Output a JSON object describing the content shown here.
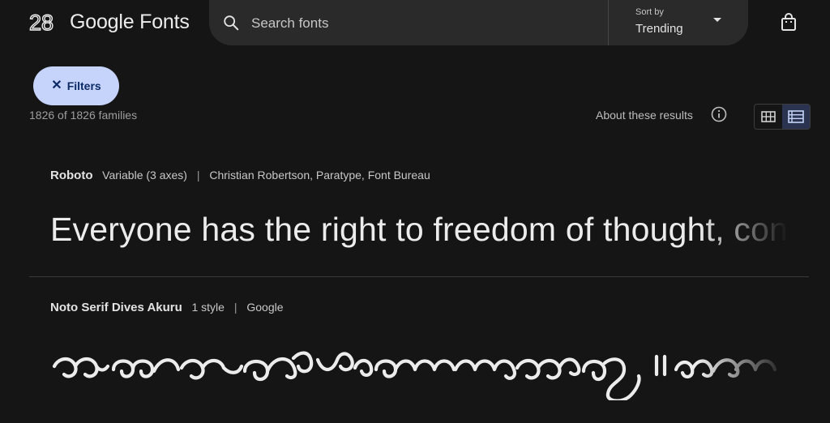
{
  "header": {
    "brand": "Google Fonts",
    "search_placeholder": "Search fonts",
    "sort_label": "Sort by",
    "sort_value": "Trending"
  },
  "toolbar": {
    "filters_label": "Filters",
    "results_count": "1826 of 1826 families",
    "about_label": "About these results"
  },
  "fonts": [
    {
      "name": "Roboto",
      "styles": "Variable (3 axes)",
      "designers": "Christian Robertson, Paratype, Font Bureau",
      "sample": "Everyone has the right to freedom of thought, cons"
    },
    {
      "name": "Noto Serif Dives Akuru",
      "styles": "1 style",
      "designers": "Google"
    }
  ],
  "colors": {
    "background": "#151515",
    "search_bg": "#2a2a2a",
    "filters_bg": "#c6d4fb",
    "filters_text": "#0b2a66"
  }
}
